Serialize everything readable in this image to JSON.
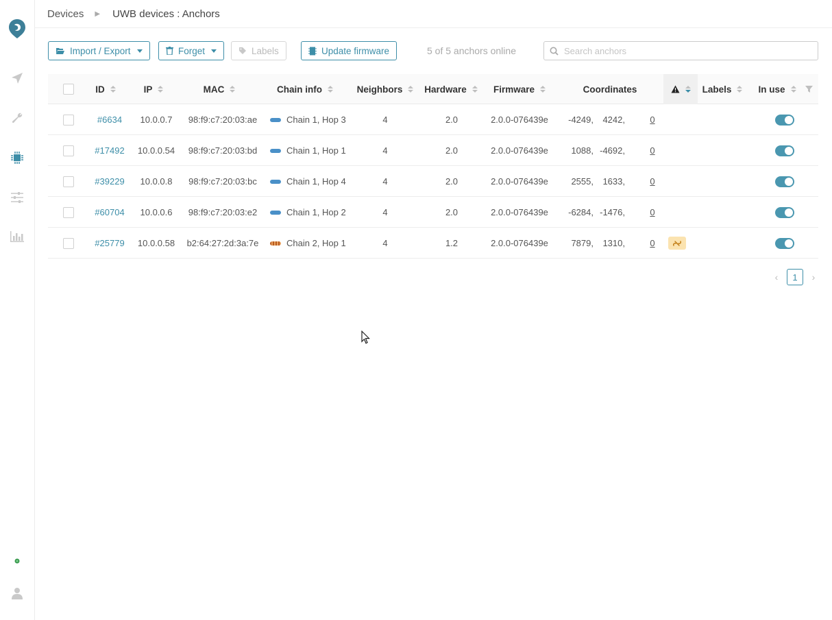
{
  "breadcrumb": {
    "root": "Devices",
    "current": "UWB devices : Anchors"
  },
  "toolbar": {
    "import_export": "Import / Export",
    "forget": "Forget",
    "labels": "Labels",
    "update_firmware": "Update firmware",
    "online_status": "5 of 5 anchors online"
  },
  "search": {
    "placeholder": "Search anchors",
    "value": ""
  },
  "table": {
    "columns": {
      "id": "ID",
      "ip": "IP",
      "mac": "MAC",
      "chain": "Chain info",
      "neighbors": "Neighbors",
      "hardware": "Hardware",
      "firmware": "Firmware",
      "coordinates": "Coordinates",
      "labels": "Labels",
      "in_use": "In use"
    },
    "rows": [
      {
        "id": "#6634",
        "ip": "10.0.0.7",
        "mac": "98:f9:c7:20:03:ae",
        "chain": "Chain 1, Hop 3",
        "neighbors": "4",
        "hardware": "2.0",
        "firmware": "2.0.0-076439e",
        "cx": "-4249,",
        "cy": "4242,",
        "cz": "0"
      },
      {
        "id": "#17492",
        "ip": "10.0.0.54",
        "mac": "98:f9:c7:20:03:bd",
        "chain": "Chain 1, Hop 1",
        "neighbors": "4",
        "hardware": "2.0",
        "firmware": "2.0.0-076439e",
        "cx": "1088,",
        "cy": "-4692,",
        "cz": "0"
      },
      {
        "id": "#39229",
        "ip": "10.0.0.8",
        "mac": "98:f9:c7:20:03:bc",
        "chain": "Chain 1, Hop 4",
        "neighbors": "4",
        "hardware": "2.0",
        "firmware": "2.0.0-076439e",
        "cx": "2555,",
        "cy": "1633,",
        "cz": "0"
      },
      {
        "id": "#60704",
        "ip": "10.0.0.6",
        "mac": "98:f9:c7:20:03:e2",
        "chain": "Chain 1, Hop 2",
        "neighbors": "4",
        "hardware": "2.0",
        "firmware": "2.0.0-076439e",
        "cx": "-6284,",
        "cy": "-1476,",
        "cz": "0"
      },
      {
        "id": "#25779",
        "ip": "10.0.0.58",
        "mac": "b2:64:27:2d:3a:7e",
        "chain": "Chain 2, Hop 1",
        "neighbors": "4",
        "hardware": "1.2",
        "firmware": "2.0.0-076439e",
        "cx": "7879,",
        "cy": "1310,",
        "cz": "0"
      }
    ]
  },
  "pagination": {
    "current": "1"
  },
  "icons": {
    "logo": "location-pin-logo-icon",
    "nav": [
      "navigation-arrow-icon",
      "wrench-icon",
      "chip-icon",
      "sliders-icon",
      "bar-chart-icon"
    ],
    "status": "connection-status-icon",
    "user": "user-icon"
  },
  "colors": {
    "accent": "#3d8ea8",
    "chain1": "#4a90c8",
    "chain2": "#b85c20",
    "warning_badge": "#fbe3b0"
  }
}
